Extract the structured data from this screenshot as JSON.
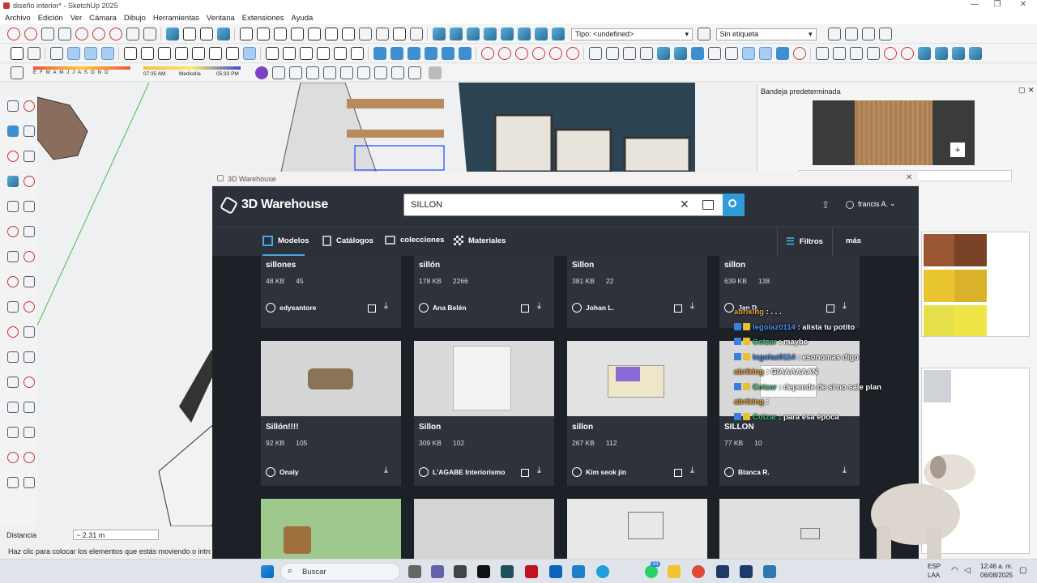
{
  "window": {
    "title": "diseño interior* - SketchUp 2025"
  },
  "menu": [
    "Archivo",
    "Edición",
    "Ver",
    "Cámara",
    "Dibujo",
    "Herramientas",
    "Ventana",
    "Extensiones",
    "Ayuda"
  ],
  "toolbar": {
    "tag_type": "Tipo: <undefined>",
    "tag_label": "Sin etiqueta",
    "shadow_months": "E F M A M J J A S O N D",
    "time_start": "07:35 AM",
    "time_mid": "Mediodía",
    "time_end": "05:33 PM"
  },
  "status": {
    "distance_label": "Distancia",
    "distance_value": "~ 2.31 m",
    "hint": "Haz clic para colocar los elementos que estás moviendo o introd"
  },
  "tray": {
    "title": "Bandeja predeterminada"
  },
  "warehouse": {
    "window_title": "3D Warehouse",
    "brand": "3D Warehouse",
    "search_value": "SILLON",
    "user": "francis A.",
    "tabs": [
      "Modelos",
      "Catálogos",
      "colecciones",
      "Materiales"
    ],
    "filters_label": "Filtros",
    "more_label": "más",
    "cards": [
      {
        "name": "sillones",
        "size": "48 KB",
        "count": "45",
        "author": "edysantore",
        "img": "#d9d9d9"
      },
      {
        "name": "sillón",
        "size": "178 KB",
        "count": "2266",
        "author": "Ana Belén",
        "img": "#d9d9d9"
      },
      {
        "name": "Sillon",
        "size": "381 KB",
        "count": "22",
        "author": "Johan L.",
        "img": "#d9d9d9"
      },
      {
        "name": "sillon",
        "size": "639 KB",
        "count": "138",
        "author": "Jan D.",
        "img": "#d9d9d9"
      },
      {
        "name": "Sillón!!!!",
        "size": "92 KB",
        "count": "105",
        "author": "Onaly",
        "img": "#d6d6d6"
      },
      {
        "name": "Sillon",
        "size": "309 KB",
        "count": "102",
        "author": "L'AGABE Interiorismo",
        "img": "#dadada"
      },
      {
        "name": "sillon",
        "size": "267 KB",
        "count": "112",
        "author": "Kim seok jin",
        "img": "#e2e2e2"
      },
      {
        "name": "SILLON",
        "size": "77 KB",
        "count": "10",
        "author": "Blanca R.",
        "img": "#d8d8d8"
      },
      {
        "name": "",
        "size": "",
        "count": "",
        "author": "",
        "img": "#9fc98c"
      },
      {
        "name": "",
        "size": "",
        "count": "",
        "author": "",
        "img": "#d4d4d4"
      },
      {
        "name": "",
        "size": "",
        "count": "",
        "author": "",
        "img": "#e8e8e8"
      },
      {
        "name": "",
        "size": "",
        "count": "",
        "author": "",
        "img": "#e0e0e0"
      }
    ]
  },
  "chat": [
    {
      "user": "abriking",
      "msg": ": . . .",
      "color": "u3"
    },
    {
      "user": "legolaz0114",
      "msg": ": alista tu potito",
      "color": "u1"
    },
    {
      "user": "Cotzar",
      "msg": ": maybe",
      "color": "u2"
    },
    {
      "user": "legolaz0114",
      "msg": ": esonomas digo",
      "color": "u1"
    },
    {
      "user": "abriking",
      "msg": ": GIAAAAAAN",
      "color": "u3"
    },
    {
      "user": "Cotzar",
      "msg": ": depende de si no sale plan",
      "color": "u2"
    },
    {
      "user": "abriking",
      "msg": ":",
      "color": "u3"
    },
    {
      "user": "Cotzar",
      "msg": ": para esa época",
      "color": "u2"
    }
  ],
  "taskbar": {
    "search": "Buscar",
    "lang": "ESP",
    "lang2": "LAA",
    "time": "12:46 a. m.",
    "date": "06/08/2025",
    "badge": "33"
  }
}
